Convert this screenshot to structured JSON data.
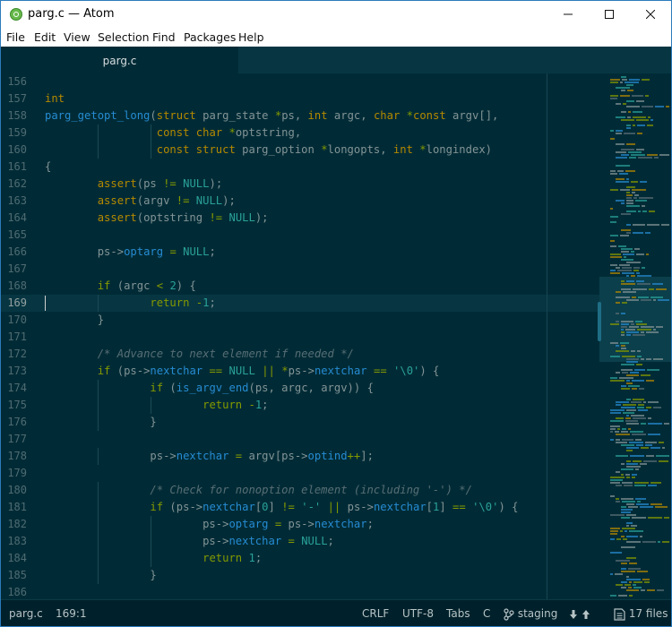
{
  "window": {
    "title": "parg.c — Atom",
    "controls": {
      "minimize": "—",
      "maximize": "☐",
      "close": "✕"
    }
  },
  "menu": [
    "File",
    "Edit",
    "View",
    "Selection",
    "Find",
    "Packages",
    "Help"
  ],
  "tabs": [
    {
      "label": "parg.c",
      "active": true
    }
  ],
  "editor": {
    "current_line": 169,
    "lines": [
      {
        "n": "156",
        "html": ""
      },
      {
        "n": "157",
        "html": "<span class='ty'>int</span>"
      },
      {
        "n": "158",
        "html": "<span class='fn'>parg_getopt_long</span>(<span class='ty'>struct</span> parg_state <span class='op'>*</span>ps, <span class='ty'>int</span> argc, <span class='ty'>char</span> <span class='op'>*</span><span class='ty'>const</span> argv[],"
      },
      {
        "n": "159",
        "html": "                 <span class='ty'>const char</span> <span class='op'>*</span>optstring,"
      },
      {
        "n": "160",
        "html": "                 <span class='ty'>const struct</span> parg_option <span class='op'>*</span>longopts, <span class='ty'>int</span> <span class='op'>*</span>longindex)"
      },
      {
        "n": "161",
        "html": "{"
      },
      {
        "n": "162",
        "html": "        <span class='mc'>assert</span>(ps <span class='op'>!=</span> <span class='nu'>NULL</span>);"
      },
      {
        "n": "163",
        "html": "        <span class='mc'>assert</span>(argv <span class='op'>!=</span> <span class='nu'>NULL</span>);"
      },
      {
        "n": "164",
        "html": "        <span class='mc'>assert</span>(optstring <span class='op'>!=</span> <span class='nu'>NULL</span>);"
      },
      {
        "n": "165",
        "html": ""
      },
      {
        "n": "166",
        "html": "        ps-&gt;<span class='mb'>optarg</span> <span class='op'>=</span> <span class='nu'>NULL</span>;"
      },
      {
        "n": "167",
        "html": ""
      },
      {
        "n": "168",
        "html": "        <span class='kw'>if</span> (argc <span class='op'>&lt;</span> <span class='nu'>2</span>) {"
      },
      {
        "n": "169",
        "html": "                <span class='kw'>return</span> <span class='op'>-</span><span class='nu'>1</span>;"
      },
      {
        "n": "170",
        "html": "        }"
      },
      {
        "n": "171",
        "html": ""
      },
      {
        "n": "172",
        "html": "        <span class='cm'>/* Advance to next element if needed */</span>"
      },
      {
        "n": "173",
        "html": "        <span class='kw'>if</span> (ps-&gt;<span class='mb'>nextchar</span> <span class='op'>==</span> <span class='nu'>NULL</span> <span class='op'>||</span> <span class='op'>*</span>ps-&gt;<span class='mb'>nextchar</span> <span class='op'>==</span> <span class='st'>'\\0'</span>) {"
      },
      {
        "n": "174",
        "html": "                <span class='kw'>if</span> (<span class='fn'>is_argv_end</span>(ps, argc, argv)) {"
      },
      {
        "n": "175",
        "html": "                        <span class='kw'>return</span> <span class='op'>-</span><span class='nu'>1</span>;"
      },
      {
        "n": "176",
        "html": "                }"
      },
      {
        "n": "177",
        "html": ""
      },
      {
        "n": "178",
        "html": "                ps-&gt;<span class='mb'>nextchar</span> <span class='op'>=</span> argv[ps-&gt;<span class='mb'>optind</span><span class='op'>++</span>];"
      },
      {
        "n": "179",
        "html": ""
      },
      {
        "n": "180",
        "html": "                <span class='cm'>/* Check for nonoption element (including '-') */</span>"
      },
      {
        "n": "181",
        "html": "                <span class='kw'>if</span> (ps-&gt;<span class='mb'>nextchar</span>[<span class='nu'>0</span>] <span class='op'>!=</span> <span class='st'>'-'</span> <span class='op'>||</span> ps-&gt;<span class='mb'>nextchar</span>[<span class='nu'>1</span>] <span class='op'>==</span> <span class='st'>'\\0'</span>) {"
      },
      {
        "n": "182",
        "html": "                        ps-&gt;<span class='mb'>optarg</span> <span class='op'>=</span> ps-&gt;<span class='mb'>nextchar</span>;"
      },
      {
        "n": "183",
        "html": "                        ps-&gt;<span class='mb'>nextchar</span> <span class='op'>=</span> <span class='nu'>NULL</span>;"
      },
      {
        "n": "184",
        "html": "                        <span class='kw'>return</span> <span class='nu'>1</span>;"
      },
      {
        "n": "185",
        "html": "                }"
      },
      {
        "n": "186",
        "html": ""
      }
    ]
  },
  "status": {
    "file": "parg.c",
    "cursor": "169:1",
    "line_ending": "CRLF",
    "encoding": "UTF-8",
    "indent": "Tabs",
    "grammar": "C",
    "branch": "staging",
    "files": "17 files",
    "git_icon": "git-branch-icon",
    "fetch_icons": [
      "arrow-down-icon",
      "arrow-up-icon"
    ],
    "files_icon": "document-icon"
  },
  "colors": {
    "background": "#002b36",
    "keyword": "#859900",
    "type": "#b58900",
    "function": "#268bd2",
    "number": "#2aa198",
    "comment": "#586e75"
  }
}
